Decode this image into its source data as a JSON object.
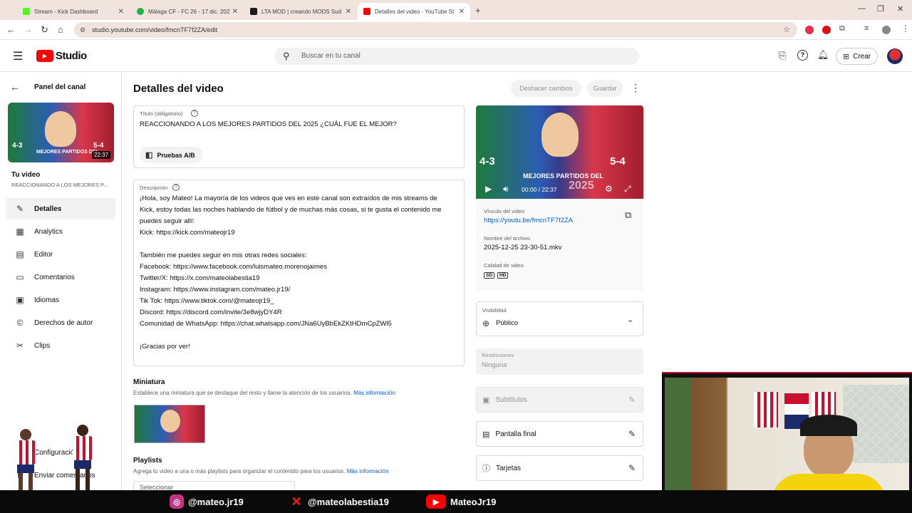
{
  "browser": {
    "tabs": [
      {
        "title": "Stream - Kick Dashboard",
        "color": "#53fc18"
      },
      {
        "title": "Málaga CF - FC 26 - 17 dic. 202",
        "color": "#1bb34b"
      },
      {
        "title": "LTA MOD | creando MODS Sud",
        "color": "#1a1a1a"
      },
      {
        "title": "Detalles del video - YouTube St",
        "color": "#ff0000"
      }
    ],
    "url": "studio.youtube.com/video/fmcnTF7f2ZA/edit"
  },
  "header": {
    "logo": "Studio",
    "search_placeholder": "Buscar en tu canal",
    "create_label": "Crear"
  },
  "sidebar": {
    "back_label": "Panel del canal",
    "thumb_duration": "22:37",
    "your_video": "Tu video",
    "video_title": "REACCIONANDO A LOS MEJORES P...",
    "items": [
      {
        "label": "Detalles",
        "icon": "pencil-icon"
      },
      {
        "label": "Analytics",
        "icon": "chart-icon"
      },
      {
        "label": "Editor",
        "icon": "film-icon"
      },
      {
        "label": "Comentarios",
        "icon": "comment-icon"
      },
      {
        "label": "Idiomas",
        "icon": "subtitles-icon"
      },
      {
        "label": "Derechos de autor",
        "icon": "copyright-icon"
      },
      {
        "label": "Clips",
        "icon": "scissors-icon"
      }
    ],
    "settings_label": "Configuración",
    "feedback_label": "Enviar comentarios"
  },
  "main": {
    "page_title": "Detalles del video",
    "undo_label": "Deshacer cambios",
    "save_label": "Guardar",
    "title_field": {
      "label": "Título (obligatorio)",
      "value": "REACCIONANDO A LOS MEJORES PARTIDOS DEL 2025 ¿CUÁL FUE EL MEJOR?"
    },
    "ab_test_label": "Pruebas A/B",
    "description_field": {
      "label": "Descripción",
      "lines": [
        "¡Hola, soy Mateo! La mayoría de los videos que ves en este canal son extraídos de mis streams de",
        "Kick, estoy todas las noches hablando de fútbol y de muchas más cosas, si te gusta el contenido me",
        "puedes seguir allí:",
        "Kick: https://kick.com/mateojr19",
        "",
        "También me puedes seguir en mis otras redes sociales:",
        "Facebook: https://www.facebook.com/luismateo.morenojaimes",
        "Twitter/X: https://x.com/mateolabestia19",
        "Instagram: https://www.instagram.com/mateo.jr19/",
        "Tik Tok: https://www.tiktok.com/@mateojr19_",
        "Discord: https://discord.com/invite/3e8wjyDY4R",
        "Comunidad de WhatsApp: https://chat.whatsapp.com/JNa6UyBbEkZKtHDmCpZWl5",
        "",
        "¡Gracias por ver!"
      ]
    },
    "thumbnail": {
      "heading": "Miniatura",
      "help": "Establece una miniatura que se destaque del resto y llame la atención de los usuarios.",
      "more": "Más información"
    },
    "playlists": {
      "heading": "Playlists",
      "help": "Agrega tu video a una o más playlists para organizar el contenido para los usuarios.",
      "more": "Más información",
      "select": "Seleccionar"
    }
  },
  "preview": {
    "time": "00:00 / 22:37",
    "score_left": "4-3",
    "score_right": "5-4",
    "banner": "MEJORES PARTIDOS DEL",
    "year": "2025",
    "link_label": "Vínculo del video",
    "link": "https://youtu.be/fmcnTF7f2ZA",
    "filename_label": "Nombre del archivo",
    "filename": "2025-12-25 23-30-51.mkv",
    "quality_label": "Calidad de video",
    "quality_sd": "SD",
    "quality_hd": "HD"
  },
  "visibility": {
    "label": "Visibilidad",
    "value": "Público"
  },
  "restrictions": {
    "label": "Restricciones",
    "value": "Ninguna"
  },
  "subtitles_label": "Subtítulos",
  "end_screen_label": "Pantalla final",
  "cards_label": "Tarjetas",
  "stream_overlay": {
    "instagram": "@mateo.jr19",
    "twitter": "@mateolabestia19",
    "youtube": "MateoJr19"
  },
  "colors": {
    "accent": "#065fd4",
    "youtube_red": "#ff0000",
    "kick_green": "#53fc18"
  }
}
